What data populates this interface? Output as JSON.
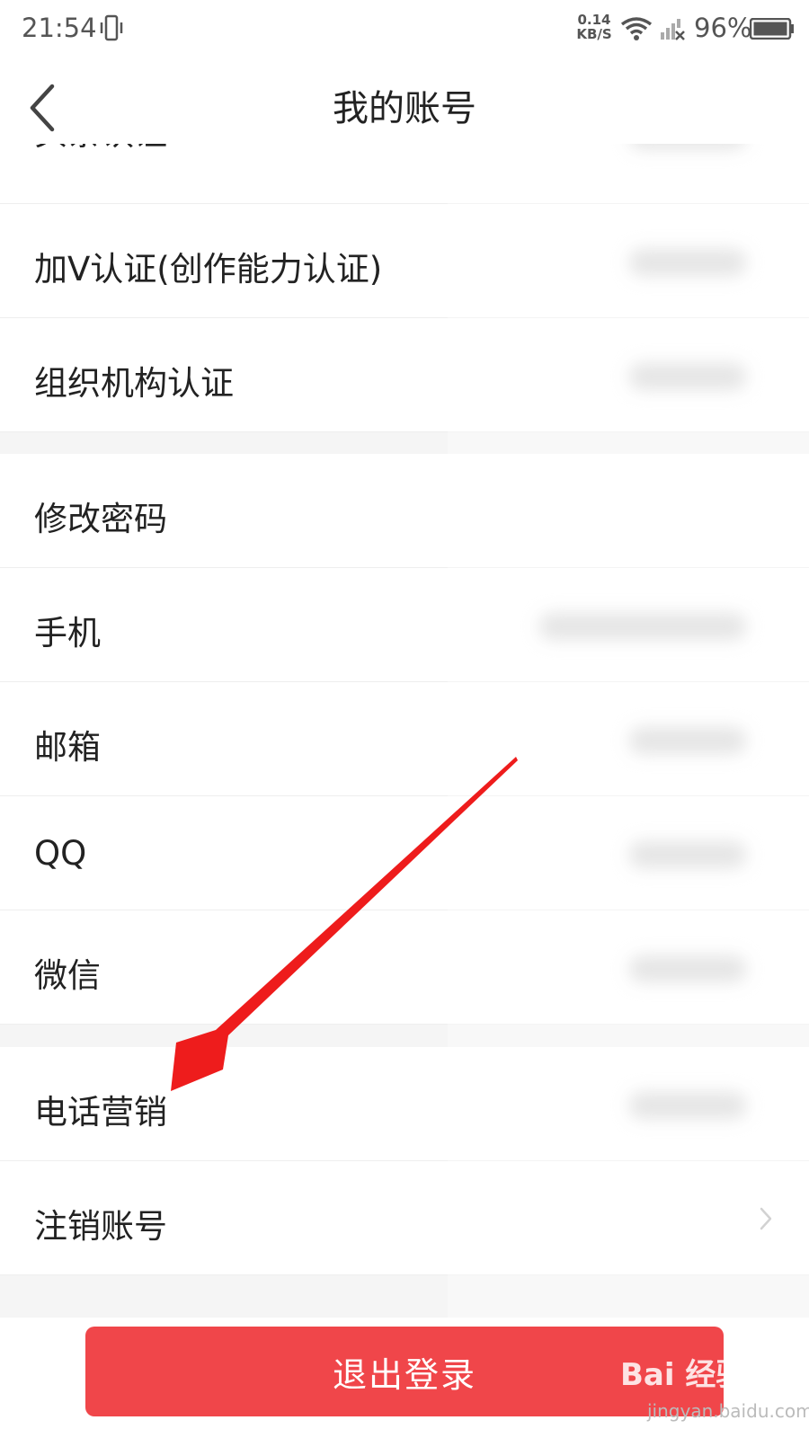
{
  "status_bar": {
    "time": "21:54",
    "net_speed_value": "0.14",
    "net_speed_unit": "KB/S",
    "battery": "96%",
    "icons": [
      "vibrate-icon",
      "wifi-icon",
      "signal-icon",
      "battery-icon"
    ]
  },
  "header": {
    "title": "我的账号",
    "back_icon": "chevron-left-icon"
  },
  "rows": [
    {
      "label": "头条认证"
    },
    {
      "label": "加V认证(创作能力认证)"
    },
    {
      "label": "组织机构认证"
    },
    {
      "label": "修改密码"
    },
    {
      "label": "手机"
    },
    {
      "label": "邮箱"
    },
    {
      "label": "QQ"
    },
    {
      "label": "微信"
    },
    {
      "label": "电话营销"
    },
    {
      "label": "注销账号"
    }
  ],
  "footer": {
    "logout_label": "退出登录"
  },
  "watermark": {
    "brand": "Bai 经验",
    "url": "jingyan.baidu.com"
  },
  "colors": {
    "accent": "#f0464a",
    "annotation_arrow": "#ee1c1c",
    "background": "#f5f5f5"
  }
}
